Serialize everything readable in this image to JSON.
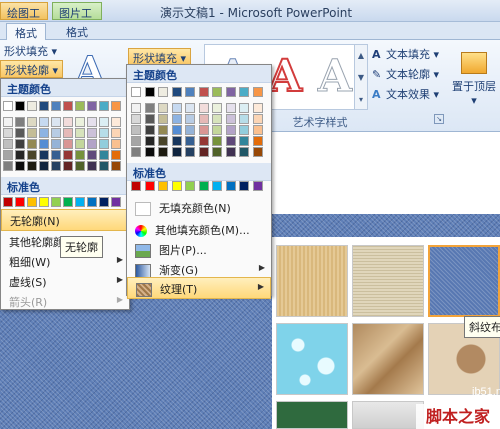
{
  "titlebar": {
    "context_tab_drawing": "绘图工具",
    "context_tab_picture": "图片工具",
    "app_title": "演示文稿1 - Microsoft PowerPoint"
  },
  "ribbon_tabs": [
    "格式",
    "格式"
  ],
  "ribbon": {
    "shape_fill_left": "形状填充 ▾",
    "shape_outline_left": "形状轮廓 ▾",
    "shape_fill_main": "形状填充 ▾",
    "wordart_group_label": "艺术字样式",
    "text_fill": "文本填充 ▾",
    "text_outline": "文本轮廓 ▾",
    "text_effects": "文本效果 ▾",
    "bring_to_front": "置于顶层 ▾",
    "wordart_letter": "A"
  },
  "outline_menu": {
    "theme_colors_header": "主题颜色",
    "standard_colors_header": "标准色",
    "items": [
      {
        "label": "无轮廓(N)"
      },
      {
        "label": "其他轮廓颜色..."
      },
      {
        "label": "粗细(W)"
      },
      {
        "label": "虚线(S)"
      },
      {
        "label": "箭头(R)"
      }
    ],
    "tooltip": "无轮廓"
  },
  "fill_menu": {
    "theme_colors_header": "主题颜色",
    "standard_colors_header": "标准色",
    "items": [
      {
        "label": "无填充颜色(N)"
      },
      {
        "label": "其他填充颜色(M)..."
      },
      {
        "label": "图片(P)..."
      },
      {
        "label": "渐变(G)"
      },
      {
        "label": "纹理(T)"
      }
    ]
  },
  "texture_tooltip": "斜纹布",
  "watermark": {
    "line1": "jb51.net",
    "line2": "脚本之家"
  },
  "colors": {
    "theme_top_row": [
      "#ffffff",
      "#000000",
      "#eeece1",
      "#1f497d",
      "#4f81bd",
      "#c0504d",
      "#9bbb59",
      "#8064a2",
      "#4bacc6",
      "#f79646"
    ],
    "theme_shades": [
      [
        "#f2f2f2",
        "#7f7f7f",
        "#ddd9c3",
        "#c6d9f0",
        "#dbe5f1",
        "#f2dcdb",
        "#ebf1dd",
        "#e5e0ec",
        "#dbeef3",
        "#fdeada"
      ],
      [
        "#d8d8d8",
        "#595959",
        "#c4bd97",
        "#8db3e2",
        "#b8cce4",
        "#e5b9b7",
        "#d7e3bc",
        "#ccc1d9",
        "#b7dde8",
        "#fbd5b5"
      ],
      [
        "#bfbfbf",
        "#3f3f3f",
        "#938953",
        "#548dd4",
        "#95b3d7",
        "#d99694",
        "#c3d69b",
        "#b2a2c7",
        "#92cddc",
        "#fac08f"
      ],
      [
        "#a5a5a5",
        "#262626",
        "#494429",
        "#17365d",
        "#366092",
        "#953734",
        "#76923c",
        "#5f497a",
        "#31859b",
        "#e36c09"
      ],
      [
        "#7f7f7f",
        "#0c0c0c",
        "#1d1b10",
        "#0f243e",
        "#244061",
        "#632423",
        "#4f6128",
        "#3f3151",
        "#205867",
        "#974806"
      ]
    ],
    "standard": [
      "#c00000",
      "#ff0000",
      "#ffc000",
      "#ffff00",
      "#92d050",
      "#00b050",
      "#00b0f0",
      "#0070c0",
      "#002060",
      "#7030a0"
    ]
  }
}
